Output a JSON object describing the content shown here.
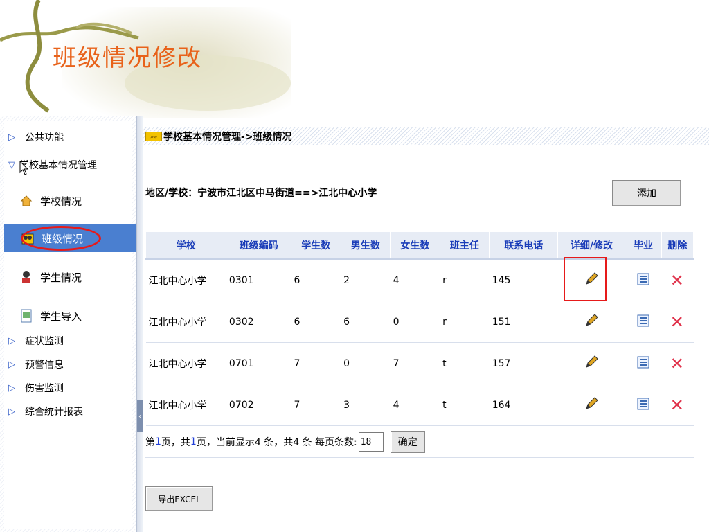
{
  "slide": {
    "title": "班级情况修改"
  },
  "sidebar": {
    "items": [
      {
        "label": "公共功能"
      },
      {
        "label": "学校基本情况管理"
      },
      {
        "label": "症状监测"
      },
      {
        "label": "预警信息"
      },
      {
        "label": "伤害监测"
      },
      {
        "label": "综合统计报表"
      }
    ],
    "sub_items": [
      {
        "label": "学校情况"
      },
      {
        "label": "班级情况"
      },
      {
        "label": "学生情况"
      },
      {
        "label": "学生导入"
      }
    ]
  },
  "main": {
    "breadcrumb": "学校基本情况管理->班级情况",
    "location": "地区/学校：宁波市江北区中马街道==>江北中心小学",
    "add_label": "添加",
    "table": {
      "headers": [
        "学校",
        "班级编码",
        "学生数",
        "男生数",
        "女生数",
        "班主任",
        "联系电话",
        "详细/修改",
        "毕业",
        "删除"
      ],
      "rows": [
        [
          "江北中心小学",
          "0301",
          "6",
          "2",
          "4",
          "r",
          "145"
        ],
        [
          "江北中心小学",
          "0302",
          "6",
          "6",
          "0",
          "r",
          "151"
        ],
        [
          "江北中心小学",
          "0701",
          "7",
          "0",
          "7",
          "t",
          "157"
        ],
        [
          "江北中心小学",
          "0702",
          "7",
          "3",
          "4",
          "t",
          "164"
        ]
      ]
    },
    "pager": {
      "p1": "第",
      "page": "1",
      "p2": "页，共",
      "total_pages": "1",
      "p3": "页，当前显示4 条，共4 条  每页条数:",
      "page_size": "18",
      "ok_label": "确定"
    },
    "export_label": "导出EXCEL"
  },
  "colors": {
    "accent": "#e8621a",
    "header_text": "#1a3cb8",
    "active": "#4a7fd0",
    "highlight": "#e61a1a"
  }
}
